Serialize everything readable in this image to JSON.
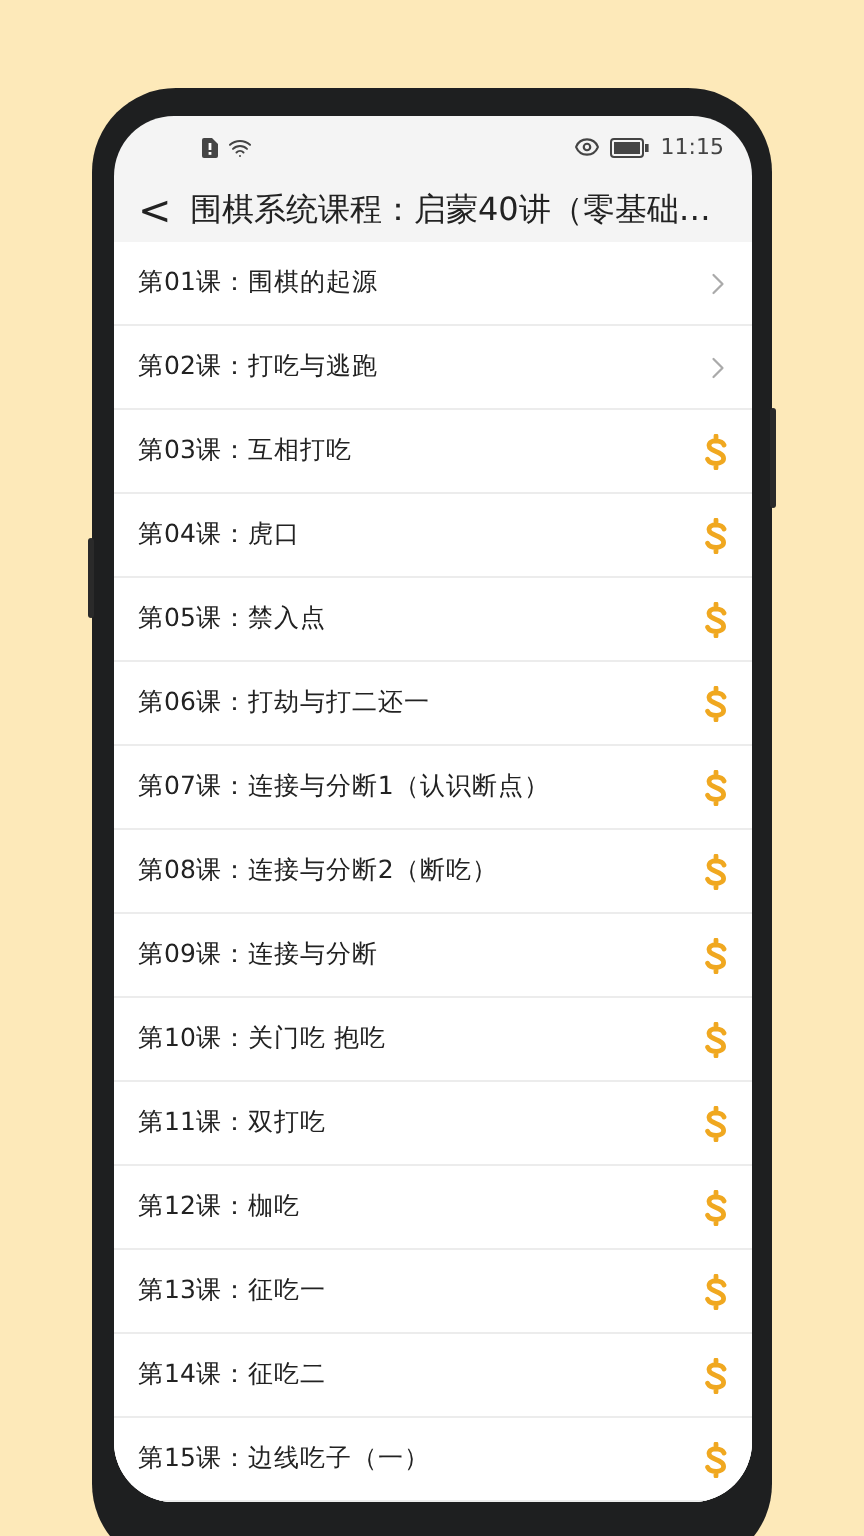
{
  "status_bar": {
    "time": "11:15"
  },
  "header": {
    "back": "<",
    "title": "围棋系统课程：启蒙40讲（零基础…"
  },
  "lessons": [
    {
      "number": "第01课：",
      "title": "围棋的起源",
      "kind": "open"
    },
    {
      "number": "第02课：",
      "title": "打吃与逃跑",
      "kind": "open"
    },
    {
      "number": "第03课：",
      "title": "互相打吃",
      "kind": "paid"
    },
    {
      "number": "第04课：",
      "title": "虎口",
      "kind": "paid"
    },
    {
      "number": "第05课：",
      "title": "禁入点",
      "kind": "paid"
    },
    {
      "number": "第06课：",
      "title": "打劫与打二还一",
      "kind": "paid"
    },
    {
      "number": "第07课：",
      "title": "连接与分断1（认识断点）",
      "kind": "paid"
    },
    {
      "number": "第08课：",
      "title": "连接与分断2（断吃）",
      "kind": "paid"
    },
    {
      "number": "第09课：",
      "title": "连接与分断",
      "kind": "paid"
    },
    {
      "number": "第10课：",
      "title": "关门吃 抱吃",
      "kind": "paid"
    },
    {
      "number": "第11课：",
      "title": "双打吃",
      "kind": "paid"
    },
    {
      "number": "第12课：",
      "title": "枷吃",
      "kind": "paid"
    },
    {
      "number": "第13课：",
      "title": "征吃一",
      "kind": "paid"
    },
    {
      "number": "第14课：",
      "title": "征吃二",
      "kind": "paid"
    },
    {
      "number": "第15课：",
      "title": "边线吃子（一）",
      "kind": "paid"
    }
  ]
}
